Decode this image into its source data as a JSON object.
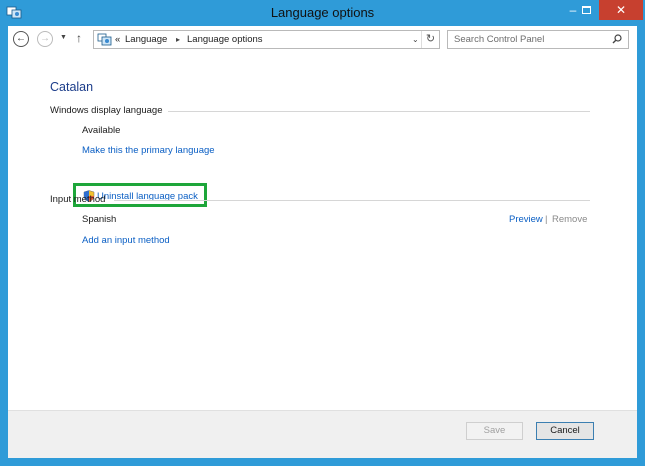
{
  "window": {
    "title": "Language options"
  },
  "titlebar": {
    "min_glyph": "–",
    "close_glyph": "✕"
  },
  "nav": {
    "back_glyph": "←",
    "forward_glyph": "→",
    "dropdown_glyph": "▼",
    "up_glyph": "↑",
    "overflow": "«",
    "breadcrumbs": [
      "Language",
      "Language options"
    ],
    "crumb_separator": "▸",
    "refresh_glyph": "↻",
    "search_placeholder": "Search Control Panel"
  },
  "main": {
    "language_name": "Catalan",
    "display_section": {
      "heading": "Windows display language",
      "status": "Available",
      "make_primary_link": "Make this the primary language",
      "uninstall_link": "Uninstall language pack"
    },
    "input_section": {
      "heading": "Input method",
      "methods": [
        {
          "name": "Spanish",
          "preview": "Preview",
          "separator": "|",
          "remove": "Remove"
        }
      ],
      "add_link": "Add an input method"
    }
  },
  "footer": {
    "save_label": "Save",
    "cancel_label": "Cancel"
  },
  "colors": {
    "titlebar": "#2f9bd8",
    "link": "#0b5fc4",
    "highlight": "#1ea63a",
    "close": "#c7402f"
  }
}
